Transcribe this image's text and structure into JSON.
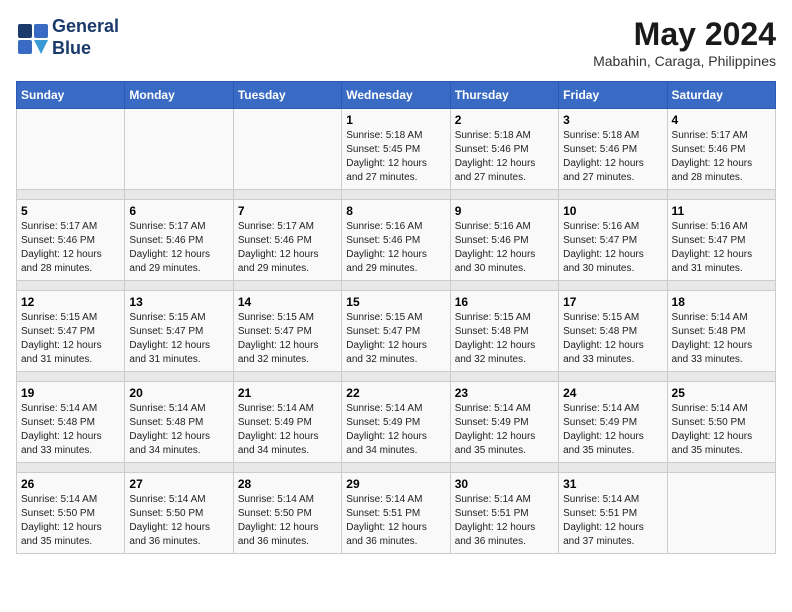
{
  "logo": {
    "line1": "General",
    "line2": "Blue"
  },
  "title": "May 2024",
  "location": "Mabahin, Caraga, Philippines",
  "headers": [
    "Sunday",
    "Monday",
    "Tuesday",
    "Wednesday",
    "Thursday",
    "Friday",
    "Saturday"
  ],
  "weeks": [
    [
      {
        "day": "",
        "sunrise": "",
        "sunset": "",
        "daylight": ""
      },
      {
        "day": "",
        "sunrise": "",
        "sunset": "",
        "daylight": ""
      },
      {
        "day": "",
        "sunrise": "",
        "sunset": "",
        "daylight": ""
      },
      {
        "day": "1",
        "sunrise": "Sunrise: 5:18 AM",
        "sunset": "Sunset: 5:45 PM",
        "daylight": "Daylight: 12 hours and 27 minutes."
      },
      {
        "day": "2",
        "sunrise": "Sunrise: 5:18 AM",
        "sunset": "Sunset: 5:46 PM",
        "daylight": "Daylight: 12 hours and 27 minutes."
      },
      {
        "day": "3",
        "sunrise": "Sunrise: 5:18 AM",
        "sunset": "Sunset: 5:46 PM",
        "daylight": "Daylight: 12 hours and 27 minutes."
      },
      {
        "day": "4",
        "sunrise": "Sunrise: 5:17 AM",
        "sunset": "Sunset: 5:46 PM",
        "daylight": "Daylight: 12 hours and 28 minutes."
      }
    ],
    [
      {
        "day": "5",
        "sunrise": "Sunrise: 5:17 AM",
        "sunset": "Sunset: 5:46 PM",
        "daylight": "Daylight: 12 hours and 28 minutes."
      },
      {
        "day": "6",
        "sunrise": "Sunrise: 5:17 AM",
        "sunset": "Sunset: 5:46 PM",
        "daylight": "Daylight: 12 hours and 29 minutes."
      },
      {
        "day": "7",
        "sunrise": "Sunrise: 5:17 AM",
        "sunset": "Sunset: 5:46 PM",
        "daylight": "Daylight: 12 hours and 29 minutes."
      },
      {
        "day": "8",
        "sunrise": "Sunrise: 5:16 AM",
        "sunset": "Sunset: 5:46 PM",
        "daylight": "Daylight: 12 hours and 29 minutes."
      },
      {
        "day": "9",
        "sunrise": "Sunrise: 5:16 AM",
        "sunset": "Sunset: 5:46 PM",
        "daylight": "Daylight: 12 hours and 30 minutes."
      },
      {
        "day": "10",
        "sunrise": "Sunrise: 5:16 AM",
        "sunset": "Sunset: 5:47 PM",
        "daylight": "Daylight: 12 hours and 30 minutes."
      },
      {
        "day": "11",
        "sunrise": "Sunrise: 5:16 AM",
        "sunset": "Sunset: 5:47 PM",
        "daylight": "Daylight: 12 hours and 31 minutes."
      }
    ],
    [
      {
        "day": "12",
        "sunrise": "Sunrise: 5:15 AM",
        "sunset": "Sunset: 5:47 PM",
        "daylight": "Daylight: 12 hours and 31 minutes."
      },
      {
        "day": "13",
        "sunrise": "Sunrise: 5:15 AM",
        "sunset": "Sunset: 5:47 PM",
        "daylight": "Daylight: 12 hours and 31 minutes."
      },
      {
        "day": "14",
        "sunrise": "Sunrise: 5:15 AM",
        "sunset": "Sunset: 5:47 PM",
        "daylight": "Daylight: 12 hours and 32 minutes."
      },
      {
        "day": "15",
        "sunrise": "Sunrise: 5:15 AM",
        "sunset": "Sunset: 5:47 PM",
        "daylight": "Daylight: 12 hours and 32 minutes."
      },
      {
        "day": "16",
        "sunrise": "Sunrise: 5:15 AM",
        "sunset": "Sunset: 5:48 PM",
        "daylight": "Daylight: 12 hours and 32 minutes."
      },
      {
        "day": "17",
        "sunrise": "Sunrise: 5:15 AM",
        "sunset": "Sunset: 5:48 PM",
        "daylight": "Daylight: 12 hours and 33 minutes."
      },
      {
        "day": "18",
        "sunrise": "Sunrise: 5:14 AM",
        "sunset": "Sunset: 5:48 PM",
        "daylight": "Daylight: 12 hours and 33 minutes."
      }
    ],
    [
      {
        "day": "19",
        "sunrise": "Sunrise: 5:14 AM",
        "sunset": "Sunset: 5:48 PM",
        "daylight": "Daylight: 12 hours and 33 minutes."
      },
      {
        "day": "20",
        "sunrise": "Sunrise: 5:14 AM",
        "sunset": "Sunset: 5:48 PM",
        "daylight": "Daylight: 12 hours and 34 minutes."
      },
      {
        "day": "21",
        "sunrise": "Sunrise: 5:14 AM",
        "sunset": "Sunset: 5:49 PM",
        "daylight": "Daylight: 12 hours and 34 minutes."
      },
      {
        "day": "22",
        "sunrise": "Sunrise: 5:14 AM",
        "sunset": "Sunset: 5:49 PM",
        "daylight": "Daylight: 12 hours and 34 minutes."
      },
      {
        "day": "23",
        "sunrise": "Sunrise: 5:14 AM",
        "sunset": "Sunset: 5:49 PM",
        "daylight": "Daylight: 12 hours and 35 minutes."
      },
      {
        "day": "24",
        "sunrise": "Sunrise: 5:14 AM",
        "sunset": "Sunset: 5:49 PM",
        "daylight": "Daylight: 12 hours and 35 minutes."
      },
      {
        "day": "25",
        "sunrise": "Sunrise: 5:14 AM",
        "sunset": "Sunset: 5:50 PM",
        "daylight": "Daylight: 12 hours and 35 minutes."
      }
    ],
    [
      {
        "day": "26",
        "sunrise": "Sunrise: 5:14 AM",
        "sunset": "Sunset: 5:50 PM",
        "daylight": "Daylight: 12 hours and 35 minutes."
      },
      {
        "day": "27",
        "sunrise": "Sunrise: 5:14 AM",
        "sunset": "Sunset: 5:50 PM",
        "daylight": "Daylight: 12 hours and 36 minutes."
      },
      {
        "day": "28",
        "sunrise": "Sunrise: 5:14 AM",
        "sunset": "Sunset: 5:50 PM",
        "daylight": "Daylight: 12 hours and 36 minutes."
      },
      {
        "day": "29",
        "sunrise": "Sunrise: 5:14 AM",
        "sunset": "Sunset: 5:51 PM",
        "daylight": "Daylight: 12 hours and 36 minutes."
      },
      {
        "day": "30",
        "sunrise": "Sunrise: 5:14 AM",
        "sunset": "Sunset: 5:51 PM",
        "daylight": "Daylight: 12 hours and 36 minutes."
      },
      {
        "day": "31",
        "sunrise": "Sunrise: 5:14 AM",
        "sunset": "Sunset: 5:51 PM",
        "daylight": "Daylight: 12 hours and 37 minutes."
      },
      {
        "day": "",
        "sunrise": "",
        "sunset": "",
        "daylight": ""
      }
    ]
  ]
}
